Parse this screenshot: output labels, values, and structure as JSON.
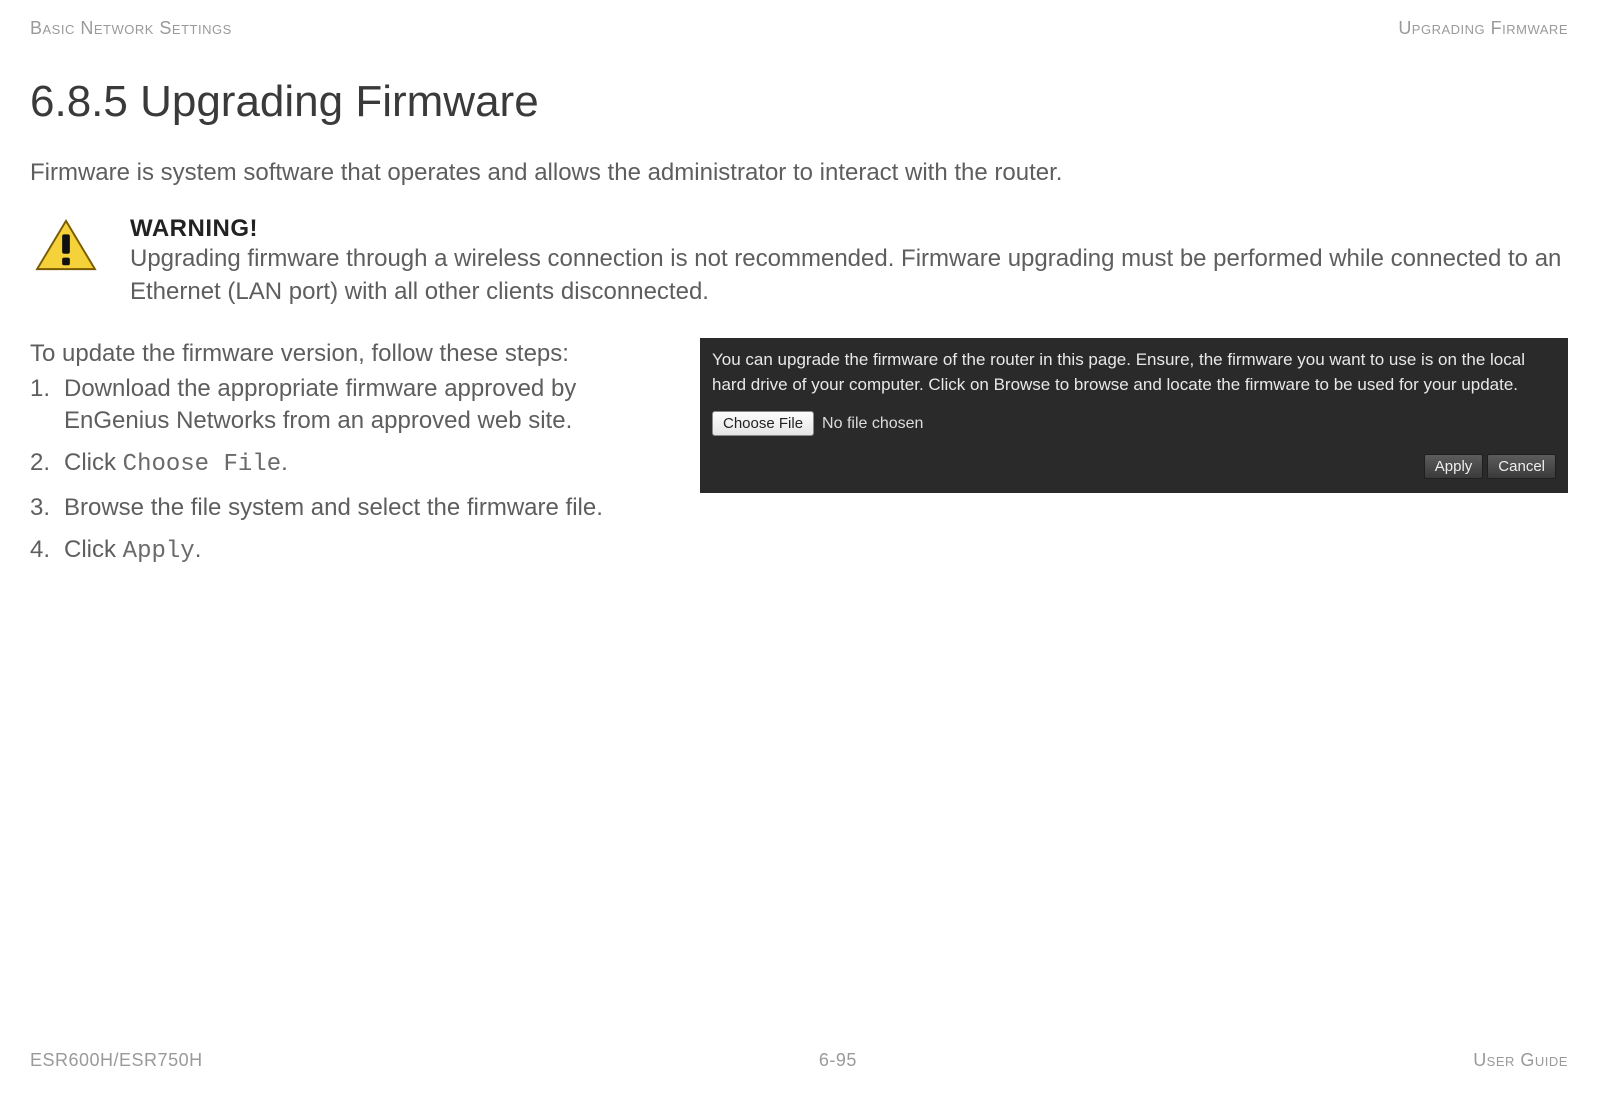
{
  "header": {
    "left": "Basic Network Settings",
    "right": "Upgrading Firmware"
  },
  "title": "6.8.5 Upgrading Firmware",
  "intro": "Firmware is system software that operates and allows the administrator to interact with the router.",
  "warning": {
    "title": "WARNING!",
    "body": "Upgrading firmware through a wireless connection is not recommended. Firmware upgrading must be performed while connected to an Ethernet (LAN port) with all other clients disconnected."
  },
  "steps": {
    "intro": "To update the firmware version, follow these steps:",
    "items": {
      "s1": "Download the appropriate firmware approved by EnGenius Networks from an approved web site.",
      "s2_pre": "Click ",
      "s2_code": "Choose File",
      "s2_post": ".",
      "s3": "Browse the file system and select the firmware file.",
      "s4_pre": "Click ",
      "s4_code": "Apply",
      "s4_post": "."
    }
  },
  "panel": {
    "description": "You can upgrade the firmware of the router in this page. Ensure, the firmware you want to use is on the local hard drive of your computer. Click on Browse to browse and locate the firmware to be used for your update.",
    "choose_file_label": "Choose File",
    "no_file_text": "No file chosen",
    "apply_label": "Apply",
    "cancel_label": "Cancel"
  },
  "footer": {
    "left": "ESR600H/ESR750H",
    "center": "6-95",
    "right": "User Guide"
  }
}
